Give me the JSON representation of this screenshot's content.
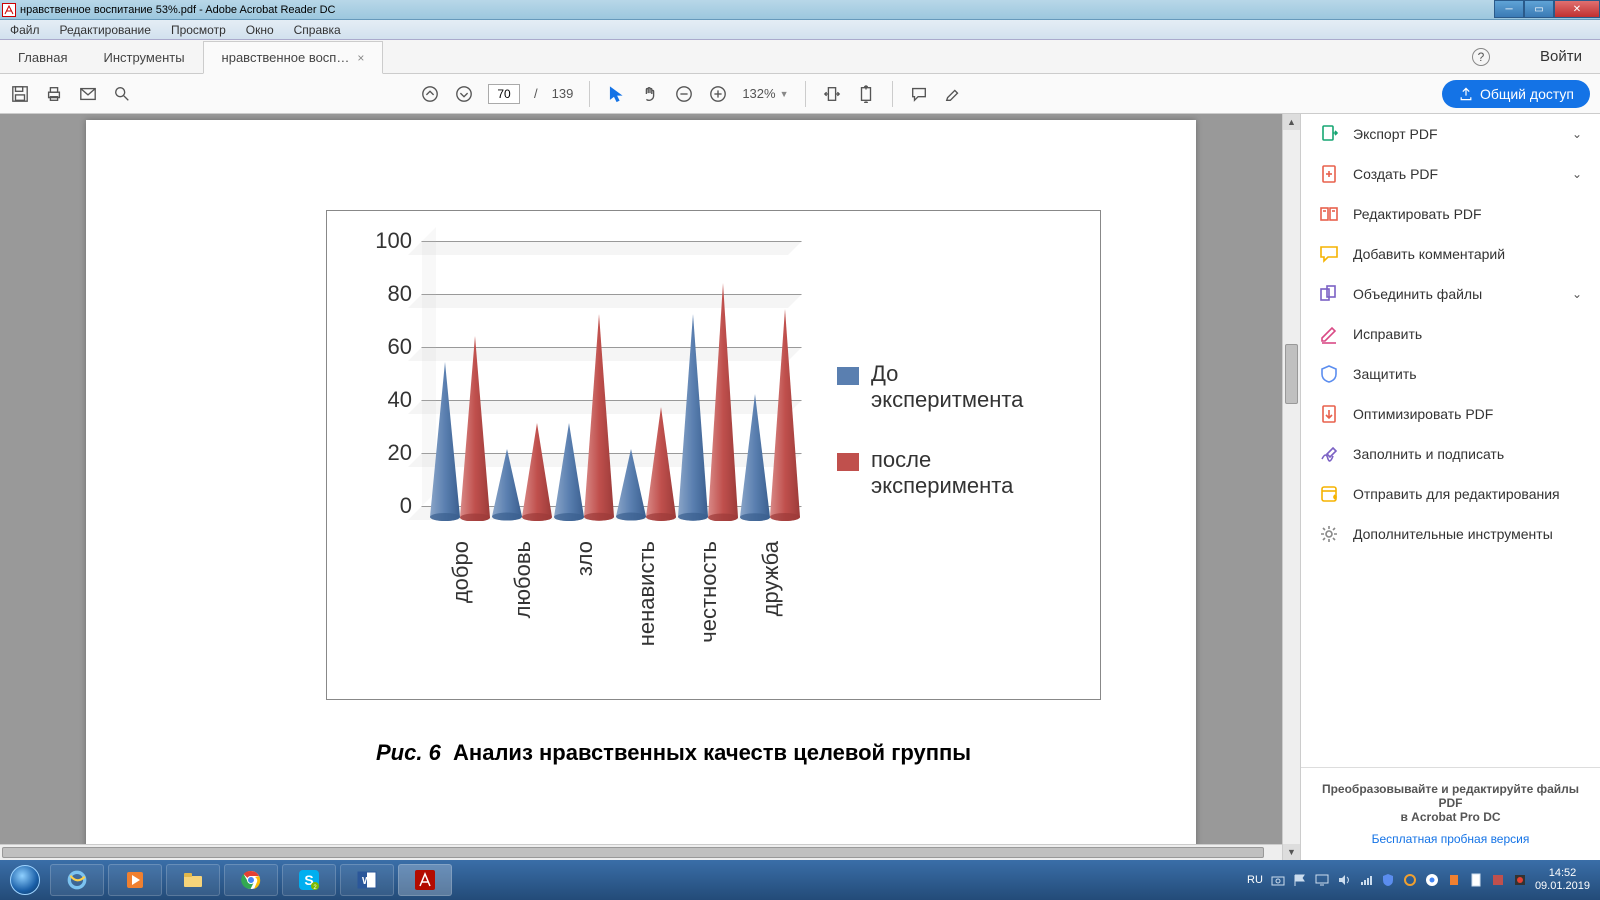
{
  "window": {
    "title": "нравственное воспитание 53%.pdf - Adobe Acrobat Reader DC"
  },
  "menu": {
    "items": [
      "Файл",
      "Редактирование",
      "Просмотр",
      "Окно",
      "Справка"
    ]
  },
  "tabs": {
    "home": "Главная",
    "tools": "Инструменты",
    "doc": "нравственное восп…",
    "signin": "Войти"
  },
  "toolbar": {
    "page_current": "70",
    "page_total": "139",
    "page_sep": "/",
    "zoom": "132%",
    "share": "Общий доступ"
  },
  "right_tools": [
    {
      "icon": "export",
      "color": "#17a673",
      "label": "Экспорт PDF",
      "expand": true
    },
    {
      "icon": "create",
      "color": "#e8604c",
      "label": "Создать PDF",
      "expand": true
    },
    {
      "icon": "edit",
      "color": "#e8604c",
      "label": "Редактировать PDF",
      "expand": false
    },
    {
      "icon": "comment",
      "color": "#f5b301",
      "label": "Добавить комментарий",
      "expand": false
    },
    {
      "icon": "combine",
      "color": "#7b61c4",
      "label": "Объединить файлы",
      "expand": true
    },
    {
      "icon": "redact",
      "color": "#d94a86",
      "label": "Исправить",
      "expand": false
    },
    {
      "icon": "protect",
      "color": "#5b8def",
      "label": "Защитить",
      "expand": false
    },
    {
      "icon": "optimize",
      "color": "#e8604c",
      "label": "Оптимизировать PDF",
      "expand": false
    },
    {
      "icon": "sign",
      "color": "#7b61c4",
      "label": "Заполнить и подписать",
      "expand": false
    },
    {
      "icon": "send",
      "color": "#f5b301",
      "label": "Отправить для редактирования",
      "expand": false
    },
    {
      "icon": "more",
      "color": "#888",
      "label": "Дополнительные инструменты",
      "expand": false
    }
  ],
  "promo": {
    "line1": "Преобразовывайте и редактируйте файлы PDF",
    "line2": "в Acrobat Pro DC",
    "link": "Бесплатная пробная версия"
  },
  "taskbar": {
    "lang": "RU",
    "time": "14:52",
    "date": "09.01.2019"
  },
  "document": {
    "caption_prefix": "Рис. 6",
    "caption_text": "Анализ нравственных качеств целевой группы"
  },
  "chart_data": {
    "type": "bar",
    "categories": [
      "добро",
      "любовь",
      "зло",
      "ненависть",
      "честность",
      "дружба"
    ],
    "series": [
      {
        "name": "До эксперитмента",
        "color": "#5a7fb0",
        "values": [
          60,
          27,
          37,
          27,
          78,
          48
        ]
      },
      {
        "name": "после эксперимента",
        "color": "#c0504d",
        "values": [
          70,
          37,
          78,
          43,
          90,
          80
        ]
      }
    ],
    "ylim": [
      0,
      100
    ],
    "yticks": [
      0,
      20,
      40,
      60,
      80,
      100
    ],
    "xlabel": "",
    "ylabel": "",
    "title": ""
  }
}
